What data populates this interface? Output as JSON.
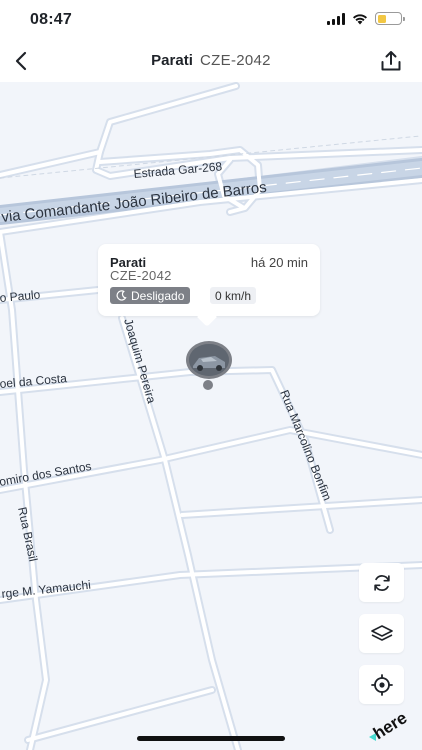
{
  "status_bar": {
    "time": "08:47"
  },
  "nav": {
    "title_name": "Parati",
    "title_plate": "CZE-2042"
  },
  "map": {
    "road_labels": {
      "estrada": "Estrada Gar-268",
      "highway": "via Comandante João Ribeiro de Barros",
      "paulo": "o Paulo",
      "joaquim": "Joaquim Pereira",
      "joel": "oel da Costa",
      "marcolino": "Rua Marcolino Bonfim",
      "omiro": "omiro dos Santos",
      "brasil": "Rua Brasil",
      "yamauchi": "rge M. Yamauchi"
    },
    "brand": "here"
  },
  "popup": {
    "name": "Parati",
    "time_ago": "há 20 min",
    "plate": "CZE-2042",
    "status": "Desligado",
    "speed": "0 km/h"
  },
  "colors": {
    "map_bg": "#f2f5fa",
    "road": "#d8e1ee",
    "badge": "#7d8087",
    "battery": "#f2c744"
  },
  "icons": {
    "back": "chevron-left-icon",
    "share": "share-icon",
    "refresh": "refresh-icon",
    "layers": "layers-icon",
    "locate": "locate-icon",
    "moon": "moon-icon"
  }
}
